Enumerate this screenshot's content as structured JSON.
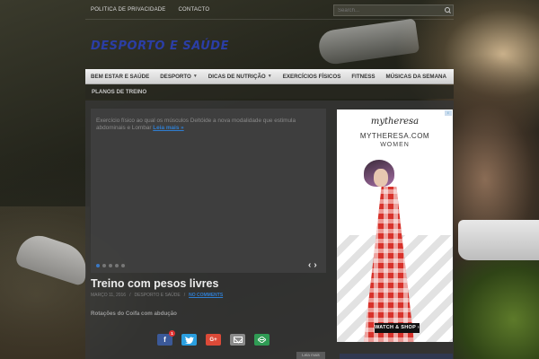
{
  "topbar": {
    "links": [
      "POLITICA DE PRIVACIDADE",
      "CONTACTO"
    ],
    "search_placeholder": "Search..."
  },
  "site": {
    "title": "DESPORTO E SAÚDE"
  },
  "nav": {
    "items": [
      {
        "label": "BEM ESTAR E SAÚDE",
        "has_dropdown": false
      },
      {
        "label": "DESPORTO",
        "has_dropdown": true
      },
      {
        "label": "DICAS DE NUTRIÇÃO",
        "has_dropdown": true
      },
      {
        "label": "EXERCÍCIOS FÍSICOS",
        "has_dropdown": false
      },
      {
        "label": "FITNESS",
        "has_dropdown": false
      },
      {
        "label": "MÚSICAS DA SEMANA",
        "has_dropdown": false
      }
    ],
    "second_row": "PLANOS DE TREINO"
  },
  "slider": {
    "text": "Exercício físico ao qual os músculos Deltóide a nova modalidade que estimula abdominais e Lombar",
    "read_more": "Leia mais »",
    "slides": 5,
    "active_slide": 1,
    "prev": "‹",
    "next": "›"
  },
  "post": {
    "title": "Treino com pesos livres",
    "date": "MARÇO 11, 2016",
    "category": "DESPORTO E SAÚDE",
    "comments": "NO COMMENTS",
    "excerpt": "Rotações do Coifa com abdução",
    "read_more_btn": "Leia mais"
  },
  "share": {
    "facebook_count": "1"
  },
  "ad": {
    "brand": "mytheresa",
    "line1": "MYTHERESA.COM",
    "line2": "WOMEN",
    "cta": "WATCH & SHOP ›",
    "adchoices": "i"
  },
  "colors": {
    "title": "#2b3ea5",
    "link": "#2f7ed1",
    "facebook": "#3b5998",
    "twitter": "#2b9fe0",
    "googleplus": "#dc4a38",
    "sharethis": "#2f9b54"
  }
}
